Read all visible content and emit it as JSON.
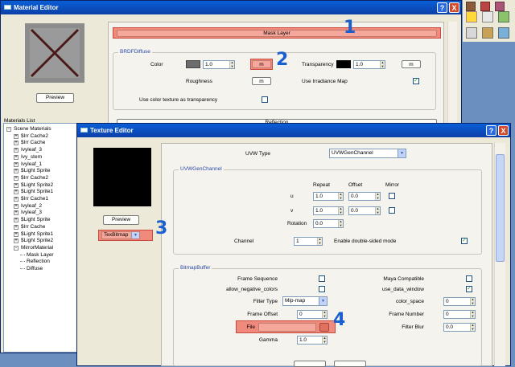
{
  "material_editor": {
    "title": "Material Editor",
    "preview_button": "Preview",
    "mask_layer_button": "Mask Layer",
    "brdf_group": "BRDFDiffuse",
    "color_label": "Color",
    "color_value": "1.0",
    "color_map_button": "m",
    "transparency_label": "Transparency",
    "transparency_value": "1.0",
    "transparency_map_button": "m",
    "roughness_label": "Roughness",
    "roughness_map_button": "m",
    "use_irradiance_label": "Use Irradiance Map",
    "use_color_texture_label": "Use color texture as transparency",
    "reflection_button": "Reflection",
    "materials_list_label": "Materials List",
    "tree": [
      {
        "label": "Scene Materials",
        "level": 0,
        "expander": "-"
      },
      {
        "label": "$Irr Cache2",
        "level": 1,
        "expander": "+"
      },
      {
        "label": "$Irr Cache",
        "level": 1,
        "expander": "+"
      },
      {
        "label": "Ivyleaf_3",
        "level": 1,
        "expander": "+"
      },
      {
        "label": "Ivy_stem",
        "level": 1,
        "expander": "+"
      },
      {
        "label": "Ivyleaf_1",
        "level": 1,
        "expander": "+"
      },
      {
        "label": "$Light Sprite",
        "level": 1,
        "expander": "+"
      },
      {
        "label": "$Irr Cache2",
        "level": 1,
        "expander": "+"
      },
      {
        "label": "$Light Sprite2",
        "level": 1,
        "expander": "+"
      },
      {
        "label": "$Light Sprite1",
        "level": 1,
        "expander": "+"
      },
      {
        "label": "$Irr Cache1",
        "level": 1,
        "expander": "+"
      },
      {
        "label": "Ivyleaf_2",
        "level": 1,
        "expander": "+"
      },
      {
        "label": "Ivyleaf_3",
        "level": 1,
        "expander": "+"
      },
      {
        "label": "$Light Sprite",
        "level": 1,
        "expander": "+"
      },
      {
        "label": "$Irr Cache",
        "level": 1,
        "expander": "+"
      },
      {
        "label": "$Light Sprite1",
        "level": 1,
        "expander": "+"
      },
      {
        "label": "$Light Sprite2",
        "level": 1,
        "expander": "+"
      },
      {
        "label": "MirrorMaterial",
        "level": 1,
        "expander": "-"
      },
      {
        "label": "Mask Layer",
        "level": 2,
        "expander": ""
      },
      {
        "label": "Reflection",
        "level": 2,
        "expander": ""
      },
      {
        "label": "Diffuse",
        "level": 2,
        "expander": ""
      }
    ]
  },
  "texture_editor": {
    "title": "Texture Editor",
    "preview_button": "Preview",
    "texture_type": "TexBitmap",
    "uvw_type_label": "UVW Type",
    "uvw_type_value": "UVWGenChannel",
    "uvw_group": "UVWGenChannel",
    "repeat_header": "Repeat",
    "offset_header": "Offset",
    "mirror_header": "Mirror",
    "u_label": "u",
    "u_repeat": "1.0",
    "u_offset": "0.0",
    "v_label": "v",
    "v_repeat": "1.0",
    "v_offset": "0.0",
    "rotation_label": "Rotation",
    "rotation_value": "0.0",
    "channel_label": "Channel",
    "channel_value": "1",
    "double_sided_label": "Enable double-sided mode",
    "bitmap_group": "BitmapBuffer",
    "frame_sequence_label": "Frame Sequence",
    "maya_compatible_label": "Maya Compatible",
    "allow_negative_label": "allow_negative_colors",
    "use_data_window_label": "use_data_window",
    "filter_type_label": "Filter Type",
    "filter_type_value": "Mip-map",
    "color_space_label": "color_space",
    "color_space_value": "0",
    "frame_offset_label": "Frame Offset",
    "frame_offset_value": "0",
    "frame_number_label": "Frame Number",
    "frame_number_value": "0",
    "file_label": "File",
    "filter_blur_label": "Filter Blur",
    "filter_blur_value": "0.0",
    "gamma_label": "Gamma",
    "gamma_value": "1.0"
  },
  "annotations": {
    "one": "1",
    "two": "2",
    "three": "3",
    "four": "4"
  },
  "titlebar_buttons": {
    "help": "?",
    "close": "X"
  },
  "colors": {
    "highlight": "#f08a7c",
    "annotation": "#1a5fd0",
    "title_bar": "#0b3fa8"
  }
}
